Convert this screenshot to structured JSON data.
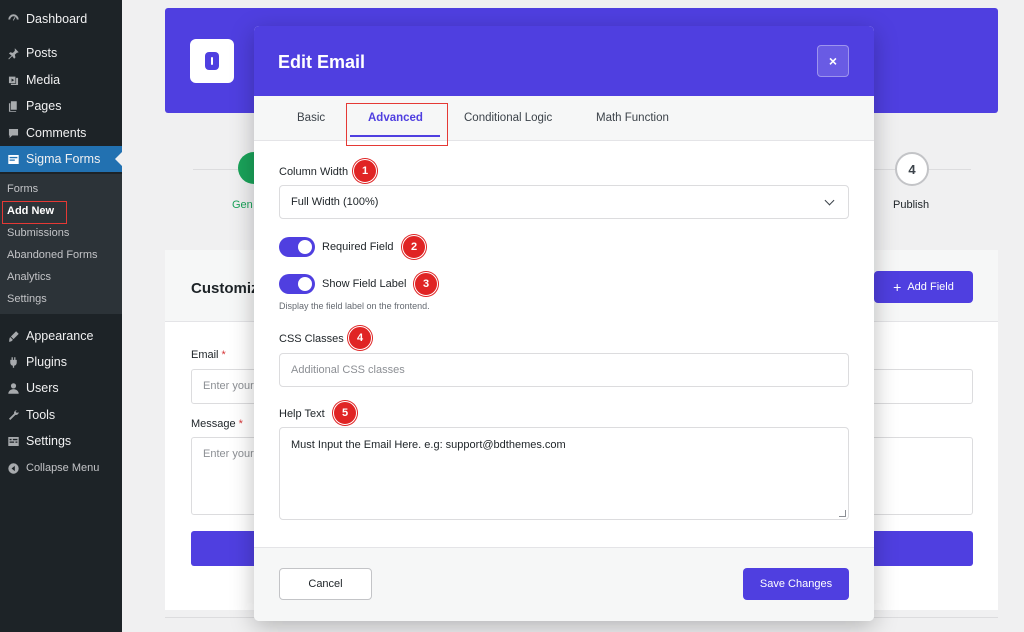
{
  "sidebar": {
    "items": [
      {
        "label": "Dashboard",
        "icon": "dashboard-icon"
      },
      {
        "label": "Posts",
        "icon": "pin-icon"
      },
      {
        "label": "Media",
        "icon": "media-icon"
      },
      {
        "label": "Pages",
        "icon": "pages-icon"
      },
      {
        "label": "Comments",
        "icon": "comment-icon"
      },
      {
        "label": "Sigma Forms",
        "icon": "forms-icon"
      },
      {
        "label": "Appearance",
        "icon": "brush-icon"
      },
      {
        "label": "Plugins",
        "icon": "plugin-icon"
      },
      {
        "label": "Users",
        "icon": "user-icon"
      },
      {
        "label": "Tools",
        "icon": "wrench-icon"
      },
      {
        "label": "Settings",
        "icon": "settings-icon"
      }
    ],
    "submenu": [
      "Forms",
      "Add New",
      "Submissions",
      "Abandoned Forms",
      "Analytics",
      "Settings"
    ],
    "collapse_label": "Collapse Menu"
  },
  "background": {
    "step_partial_label": "Gen",
    "step_number": "4",
    "step_label": "Publish",
    "card_title": "Customiz",
    "add_field_label": "Add Field",
    "email_label": "Email",
    "message_label": "Message",
    "required_mark": "*",
    "email_placeholder": "Enter your",
    "message_placeholder": "Enter your"
  },
  "modal": {
    "title": "Edit Email",
    "close_symbol": "×",
    "tabs": [
      "Basic",
      "Advanced",
      "Conditional Logic",
      "Math Function"
    ],
    "active_tab": "Advanced",
    "column_width": {
      "label": "Column Width",
      "value": "Full Width (100%)"
    },
    "required_field": {
      "label": "Required Field",
      "on": true
    },
    "show_field_label": {
      "label": "Show Field Label",
      "on": true,
      "hint": "Display the field label on the frontend."
    },
    "css_classes": {
      "label": "CSS Classes",
      "placeholder": "Additional CSS classes"
    },
    "help_text": {
      "label": "Help Text",
      "value": "Must Input the Email Here. e.g: support@bdthemes.com"
    },
    "cancel_label": "Cancel",
    "save_label": "Save Changes"
  },
  "annotations": [
    "1",
    "2",
    "3",
    "4",
    "5"
  ],
  "colors": {
    "primary": "#4f3fe0",
    "sidebar": "#1d2327",
    "sidebar_active": "#2271b1",
    "annotation": "#e02424",
    "success": "#1aa35a"
  }
}
